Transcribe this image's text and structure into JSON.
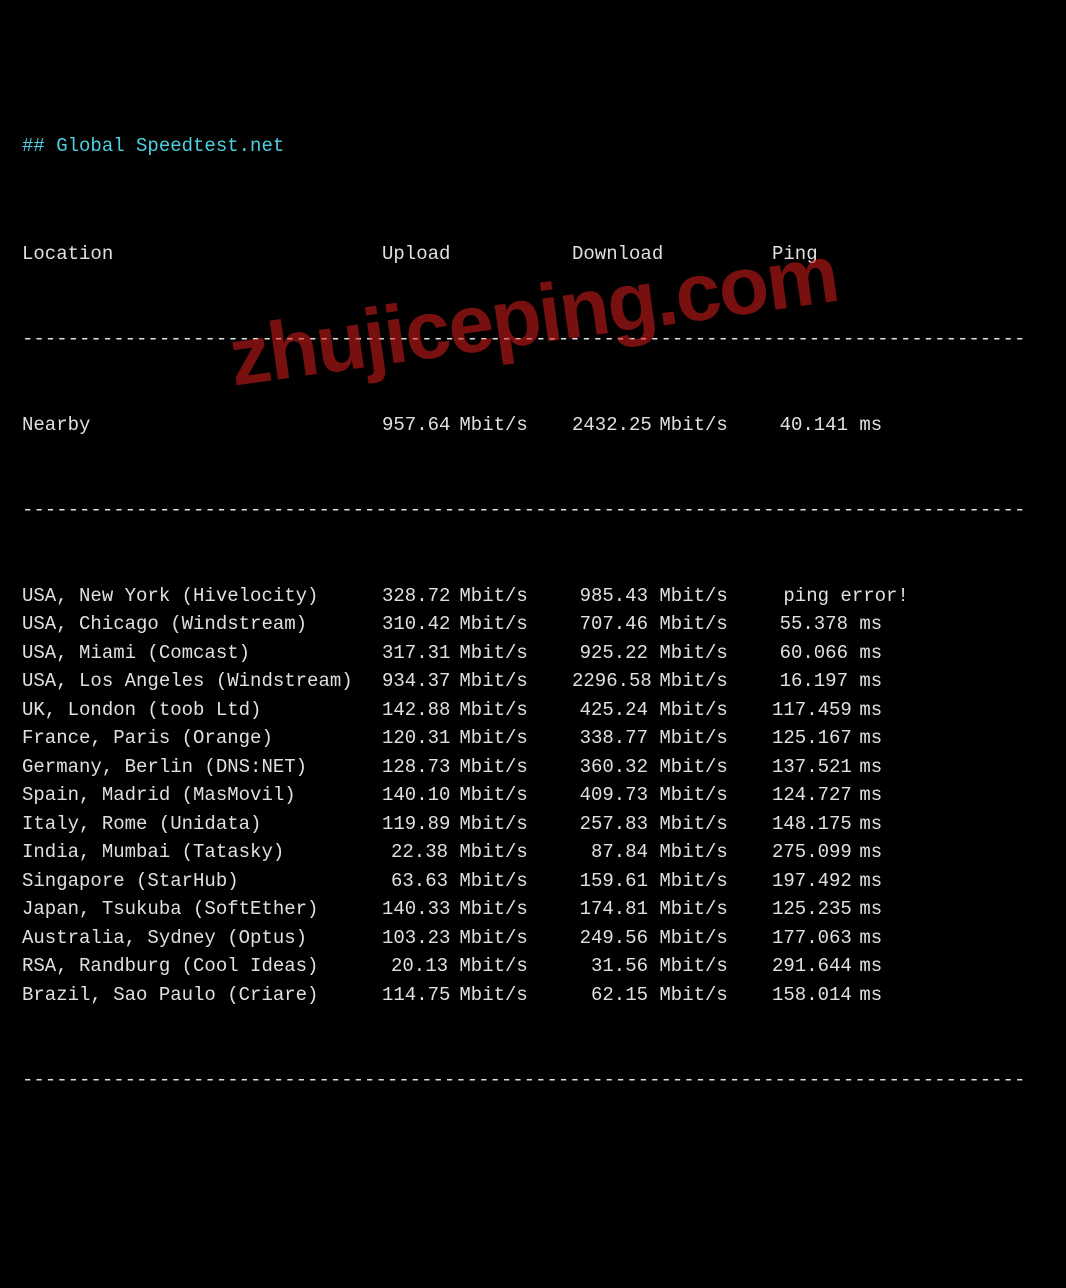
{
  "title": "## Global Speedtest.net",
  "headers": {
    "location": "Location",
    "upload": "Upload",
    "download": "Download",
    "ping": "Ping"
  },
  "divider": "----------------------------------------------------------------------------------------",
  "unit_speed": " Mbit/s",
  "unit_ping": " ms",
  "nearby": {
    "location": "Nearby",
    "upload": "957.64",
    "download": "2432.25",
    "ping": "40.141"
  },
  "rows": [
    {
      "location": "USA, New York (Hivelocity)",
      "upload": "328.72",
      "download": "985.43",
      "ping": "ping error!",
      "ping_raw": true
    },
    {
      "location": "USA, Chicago (Windstream)",
      "upload": "310.42",
      "download": "707.46",
      "ping": "55.378"
    },
    {
      "location": "USA, Miami (Comcast)",
      "upload": "317.31",
      "download": "925.22",
      "ping": "60.066"
    },
    {
      "location": "USA, Los Angeles (Windstream)",
      "upload": "934.37",
      "download": "2296.58",
      "ping": "16.197"
    },
    {
      "location": "UK, London (toob Ltd)",
      "upload": "142.88",
      "download": "425.24",
      "ping": "117.459"
    },
    {
      "location": "France, Paris (Orange)",
      "upload": "120.31",
      "download": "338.77",
      "ping": "125.167"
    },
    {
      "location": "Germany, Berlin (DNS:NET)",
      "upload": "128.73",
      "download": "360.32",
      "ping": "137.521"
    },
    {
      "location": "Spain, Madrid (MasMovil)",
      "upload": "140.10",
      "download": "409.73",
      "ping": "124.727"
    },
    {
      "location": "Italy, Rome (Unidata)",
      "upload": "119.89",
      "download": "257.83",
      "ping": "148.175"
    },
    {
      "location": "India, Mumbai (Tatasky)",
      "upload": "22.38",
      "download": "87.84",
      "ping": "275.099"
    },
    {
      "location": "Singapore (StarHub)",
      "upload": "63.63",
      "download": "159.61",
      "ping": "197.492"
    },
    {
      "location": "Japan, Tsukuba (SoftEther)",
      "upload": "140.33",
      "download": "174.81",
      "ping": "125.235"
    },
    {
      "location": "Australia, Sydney (Optus)",
      "upload": "103.23",
      "download": "249.56",
      "ping": "177.063"
    },
    {
      "location": "RSA, Randburg (Cool Ideas)",
      "upload": "20.13",
      "download": "31.56",
      "ping": "291.644"
    },
    {
      "location": "Brazil, Sao Paulo (Criare)",
      "upload": "114.75",
      "download": "62.15",
      "ping": "158.014"
    }
  ],
  "watermark": "zhujiceping.com"
}
